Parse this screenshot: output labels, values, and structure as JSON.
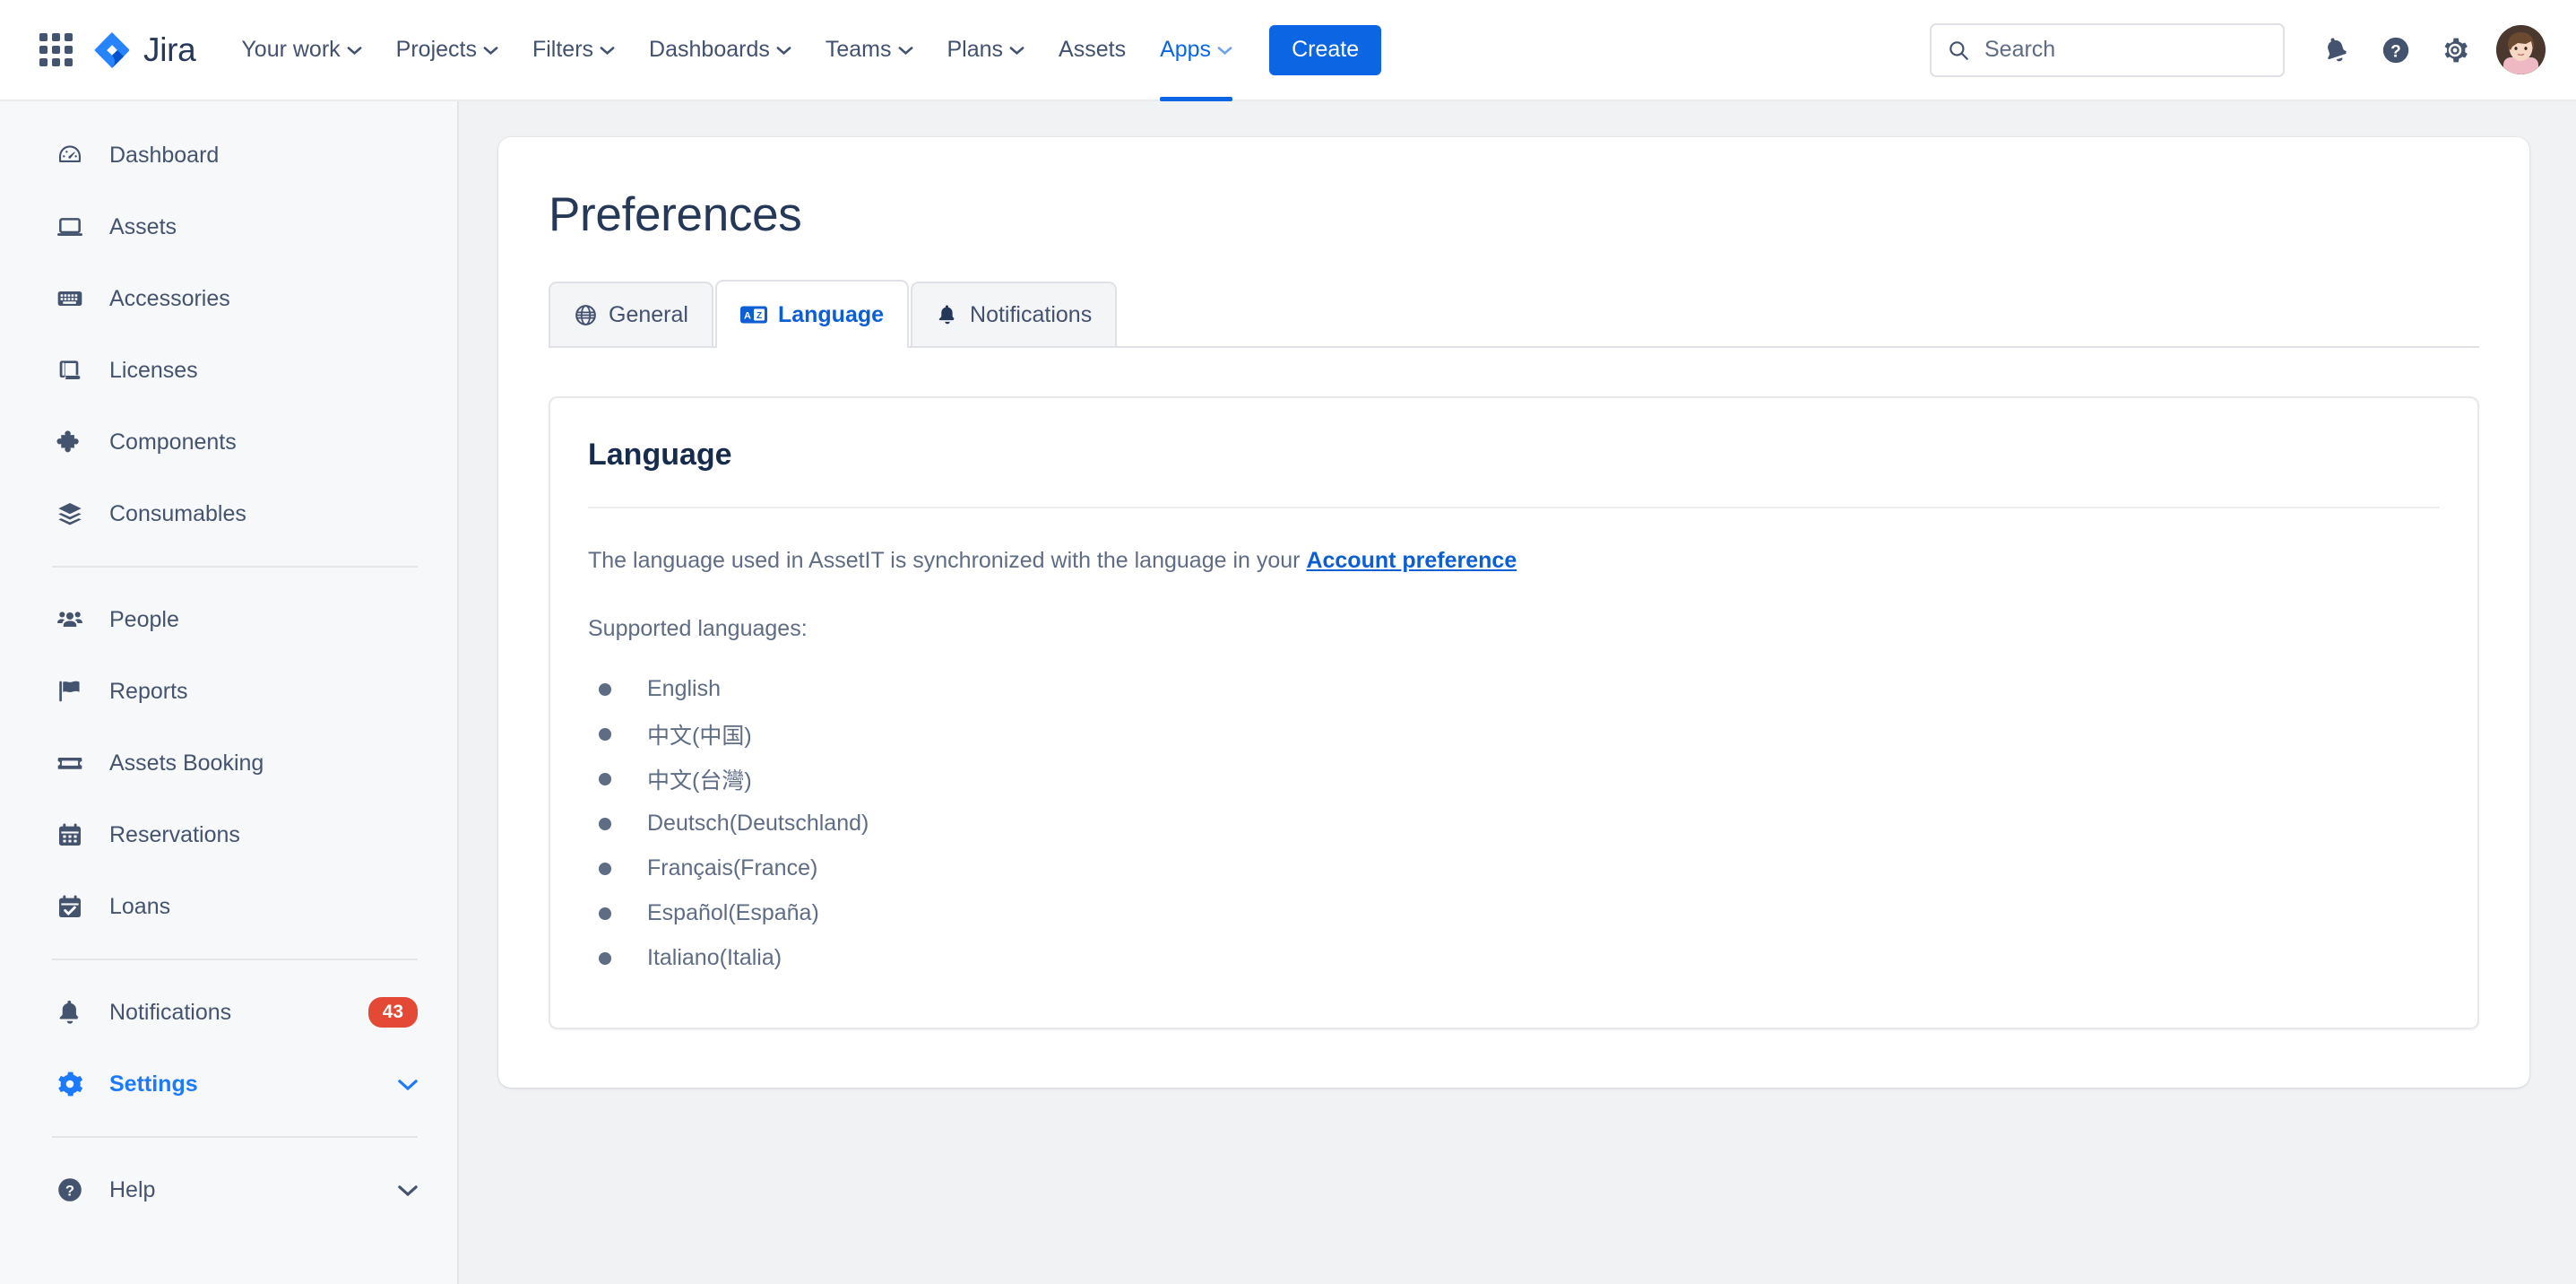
{
  "brand": {
    "name": "Jira",
    "app_switcher": "app-switcher"
  },
  "topnav": {
    "items": [
      {
        "label": "Your work",
        "has_caret": true,
        "active": false
      },
      {
        "label": "Projects",
        "has_caret": true,
        "active": false
      },
      {
        "label": "Filters",
        "has_caret": true,
        "active": false
      },
      {
        "label": "Dashboards",
        "has_caret": true,
        "active": false
      },
      {
        "label": "Teams",
        "has_caret": true,
        "active": false
      },
      {
        "label": "Plans",
        "has_caret": true,
        "active": false
      },
      {
        "label": "Assets",
        "has_caret": false,
        "active": false
      },
      {
        "label": "Apps",
        "has_caret": true,
        "active": true
      }
    ],
    "create_label": "Create"
  },
  "search": {
    "placeholder": "Search",
    "value": ""
  },
  "header_icons": [
    {
      "name": "notifications-bell-icon"
    },
    {
      "name": "help-icon"
    },
    {
      "name": "settings-gear-icon"
    },
    {
      "name": "avatar"
    }
  ],
  "sidebar": {
    "group1": [
      {
        "label": "Dashboard",
        "icon": "speedometer-icon"
      },
      {
        "label": "Assets",
        "icon": "laptop-icon"
      },
      {
        "label": "Accessories",
        "icon": "keyboard-icon"
      },
      {
        "label": "Licenses",
        "icon": "scroll-icon"
      },
      {
        "label": "Components",
        "icon": "puzzle-piece-icon"
      },
      {
        "label": "Consumables",
        "icon": "layers-icon"
      }
    ],
    "group2": [
      {
        "label": "People",
        "icon": "people-icon"
      },
      {
        "label": "Reports",
        "icon": "flag-icon"
      },
      {
        "label": "Assets Booking",
        "icon": "ticket-icon"
      },
      {
        "label": "Reservations",
        "icon": "calendar-icon"
      },
      {
        "label": "Loans",
        "icon": "calendar-check-icon"
      }
    ],
    "group3": [
      {
        "label": "Notifications",
        "icon": "bell-icon",
        "badge": "43"
      },
      {
        "label": "Settings",
        "icon": "gear-icon",
        "active": true,
        "chevron": true
      }
    ],
    "group4": [
      {
        "label": "Help",
        "icon": "help-circle-icon",
        "chevron": true
      }
    ]
  },
  "main": {
    "page_title": "Preferences",
    "tabs": [
      {
        "label": "General",
        "icon": "globe-icon",
        "active": false
      },
      {
        "label": "Language",
        "icon": "translate-icon",
        "active": true
      },
      {
        "label": "Notifications",
        "icon": "bell-icon",
        "active": false
      }
    ],
    "card": {
      "title": "Language",
      "description_before": "The language used in AssetIT is synchronized with the language in your ",
      "link_text": "Account preference",
      "supported_label": "Supported languages:",
      "languages": [
        "English",
        "中文(中国)",
        "中文(台灣)",
        "Deutsch(Deutschland)",
        "Français(France)",
        "Español(España)",
        "Italiano(Italia)"
      ]
    }
  },
  "colors": {
    "brand_blue": "#0c66e4",
    "active_blue": "#1d7afc",
    "badge_red": "#e34935",
    "text_dark": "#172b4d",
    "text_muted": "#5e6c84",
    "sidebar_bg": "#f7f8f9",
    "main_bg": "#f1f2f4"
  }
}
